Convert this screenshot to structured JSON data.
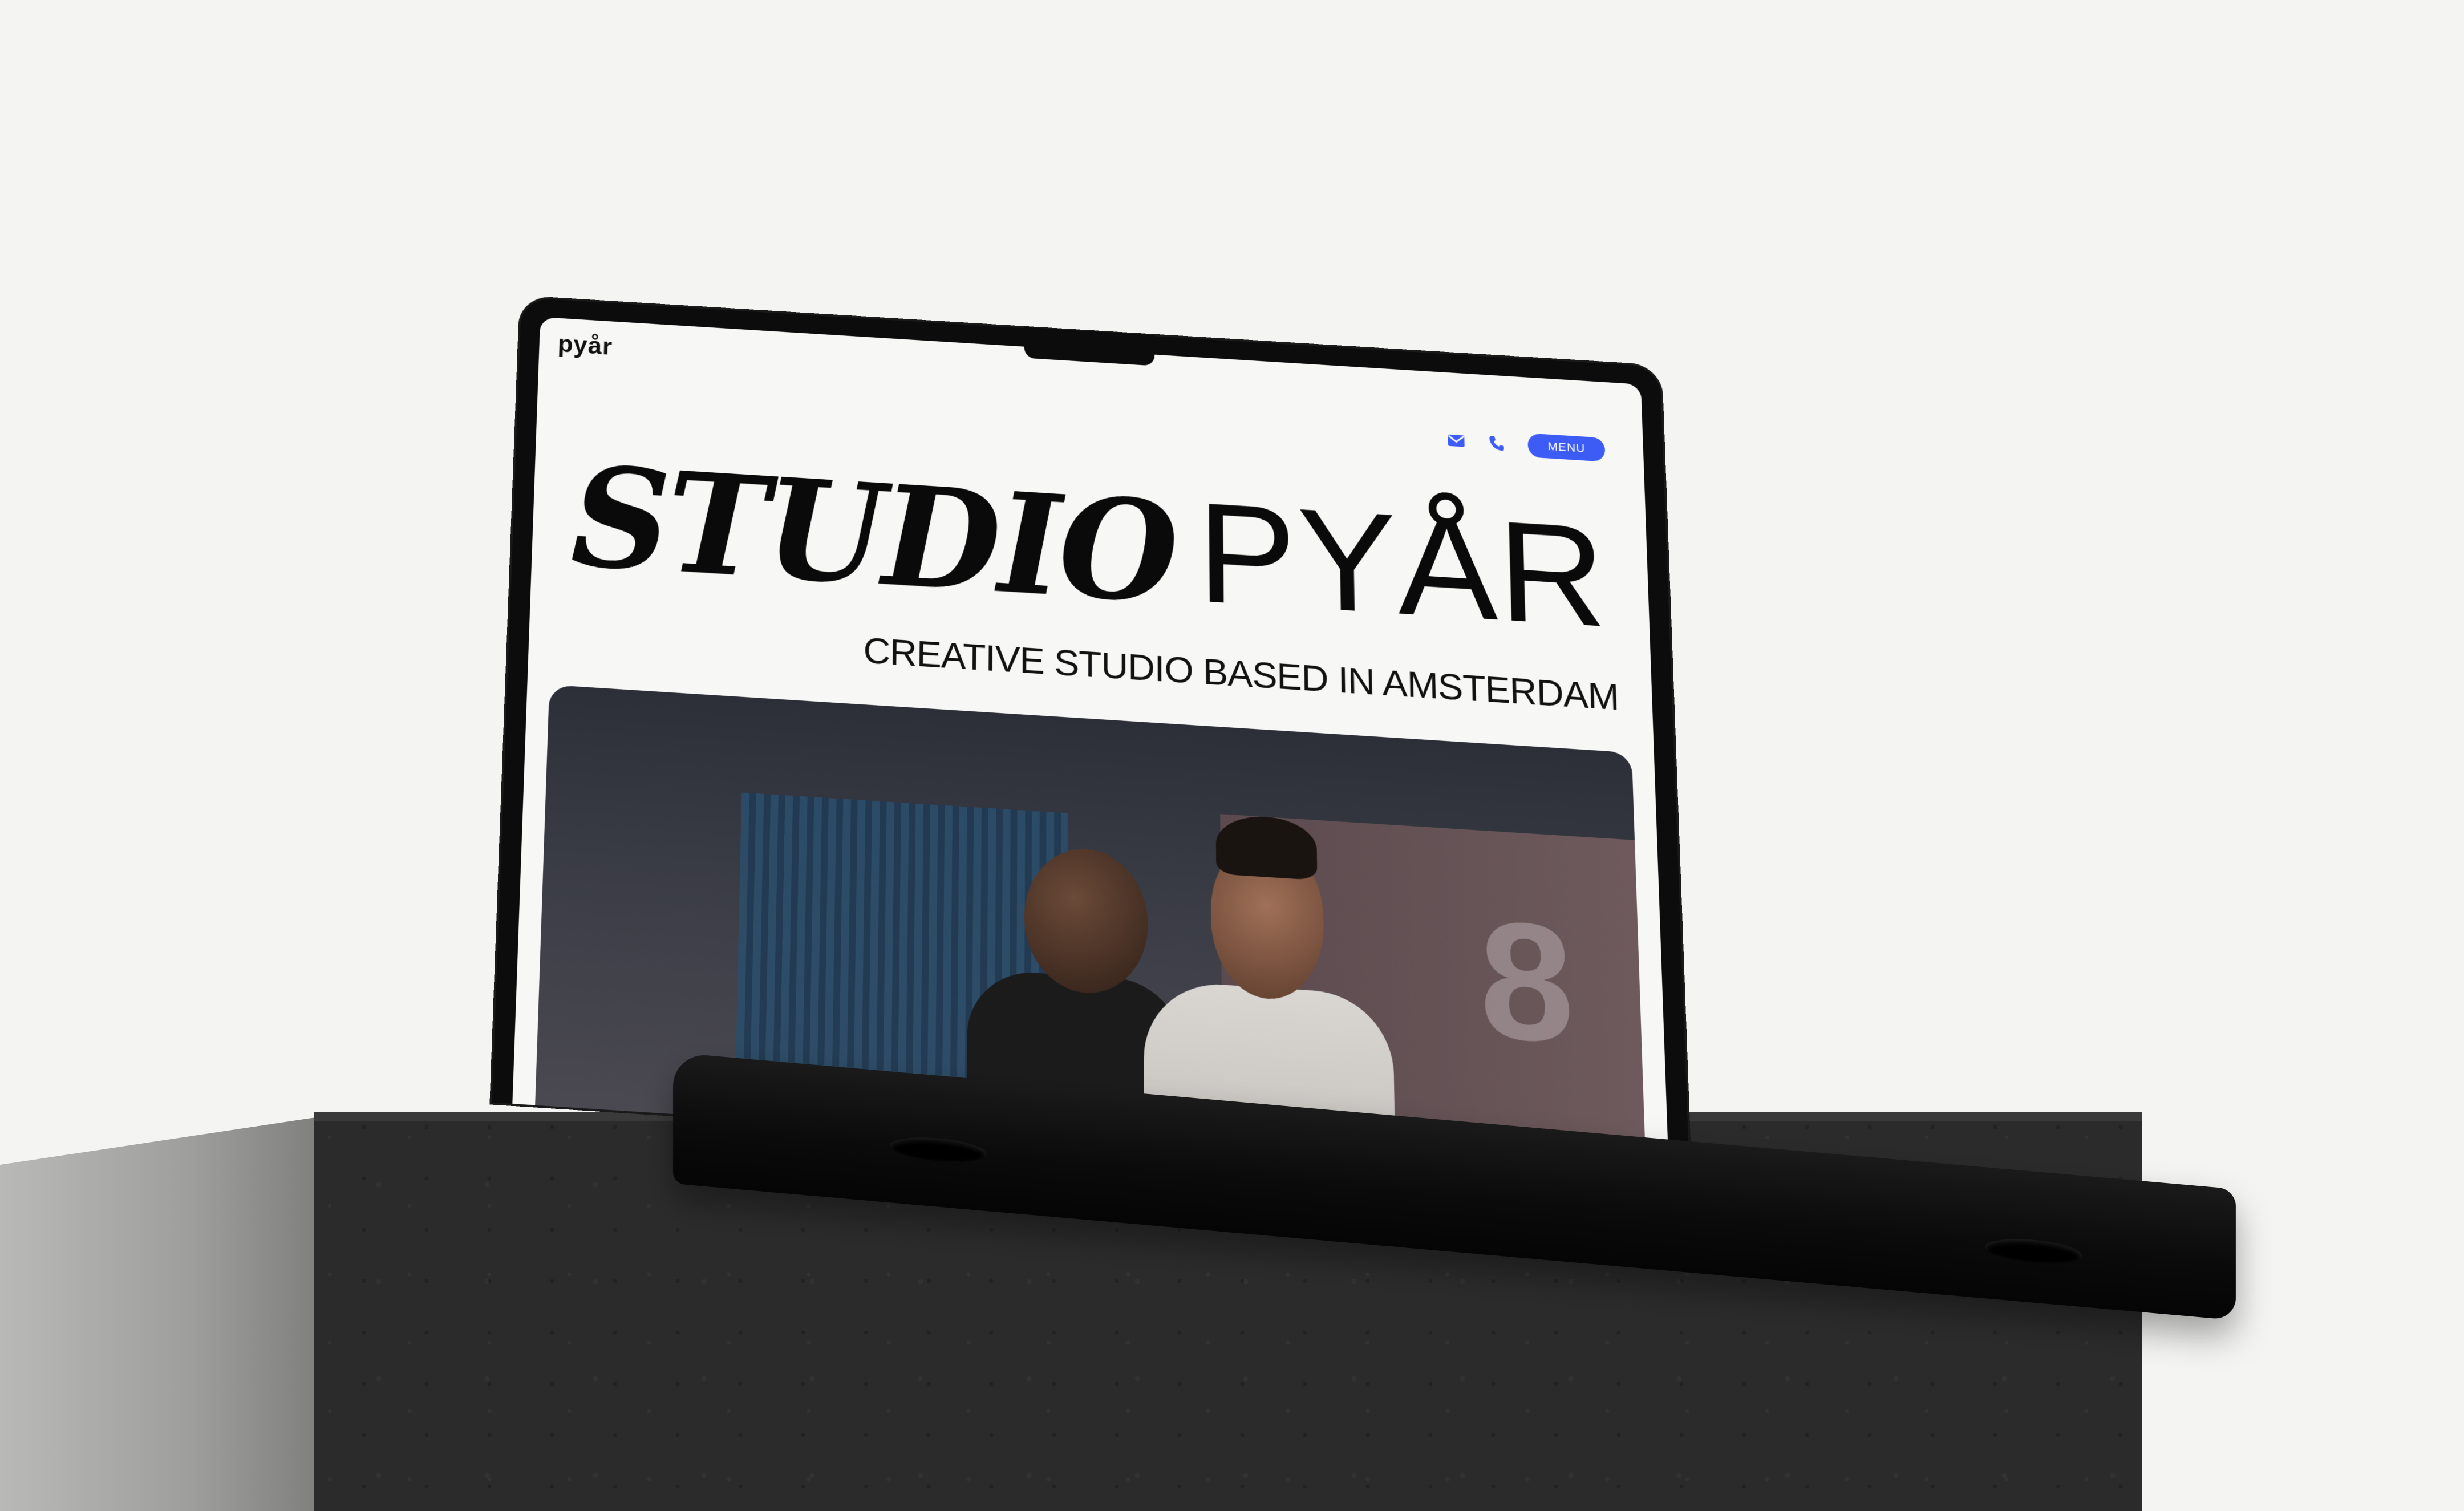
{
  "site": {
    "logo_text": "pyår",
    "nav": {
      "email_icon": "envelope-icon",
      "phone_icon": "phone-icon",
      "menu_label": "MENU",
      "menu_color": "#3d5cf5"
    },
    "hero": {
      "title_script": "STUDIO",
      "title_sans": "PYÅR",
      "subtitle": "CREATIVE STUDIO BASED IN AMSTERDAM"
    }
  }
}
